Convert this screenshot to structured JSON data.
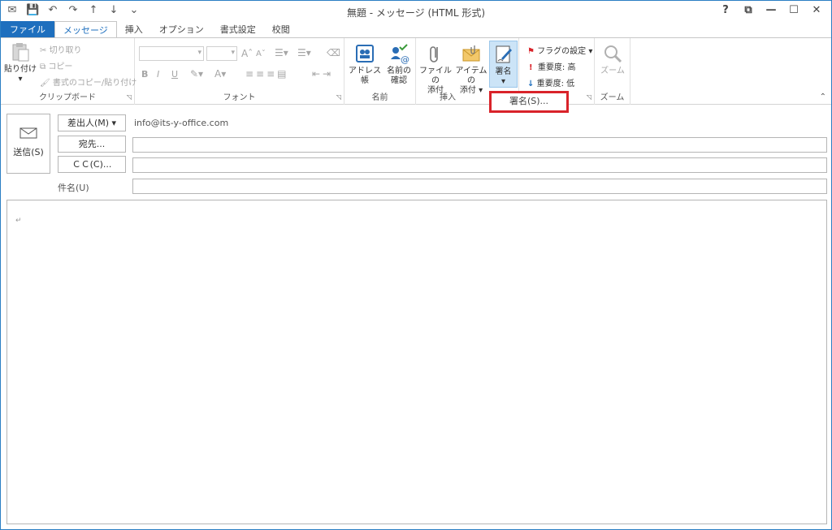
{
  "window": {
    "title": "無題 - メッセージ (HTML 形式)",
    "qat": [
      "✉",
      "💾",
      "↶",
      "↷",
      "↑",
      "↓",
      "⌄"
    ],
    "controls": [
      "?",
      "⧉",
      "—",
      "☐",
      "✕"
    ]
  },
  "tabs": [
    {
      "label": "ファイル"
    },
    {
      "label": "メッセージ"
    },
    {
      "label": "挿入"
    },
    {
      "label": "オプション"
    },
    {
      "label": "書式設定"
    },
    {
      "label": "校閲"
    }
  ],
  "ribbon": {
    "clipboard": {
      "label": "クリップボード",
      "paste": "貼り付け",
      "cut": "切り取り",
      "copy": "コピー",
      "format_painter": "書式のコピー/貼り付け"
    },
    "font": {
      "label": "フォント",
      "bold": "B",
      "italic": "I",
      "underline": "U",
      "grow": "A",
      "shrink": "A",
      "font_color": "A"
    },
    "names": {
      "label": "名前",
      "address_book": "アドレス帳",
      "check_names_1": "名前の",
      "check_names_2": "確認"
    },
    "insert": {
      "label": "挿入",
      "attach_file_1": "ファイルの",
      "attach_file_2": "添付",
      "attach_item_1": "アイテムの",
      "attach_item_2": "添付 ▾",
      "signature": "署名",
      "signature_arrow": "▾"
    },
    "tags": {
      "follow_up": "フラグの設定 ▾",
      "high": "重要度: 高",
      "low": "重要度: 低",
      "high_mark": "!",
      "low_mark": "↓"
    },
    "zoom": {
      "label": "ズーム",
      "zoom": "ズーム"
    },
    "signature_menu_item": "署名(S)..."
  },
  "header": {
    "send": "送信(S)",
    "from_button": "差出人(M) ▾",
    "from_value": "info@its-y-office.com",
    "to_button": "宛先...",
    "cc_button": "ＣＣ(C)...",
    "subject_label": "件名(U)"
  },
  "body": {
    "para_mark": "↵"
  },
  "colors": {
    "accent": "#1e6fbe",
    "highlight_border": "#d9232a"
  }
}
